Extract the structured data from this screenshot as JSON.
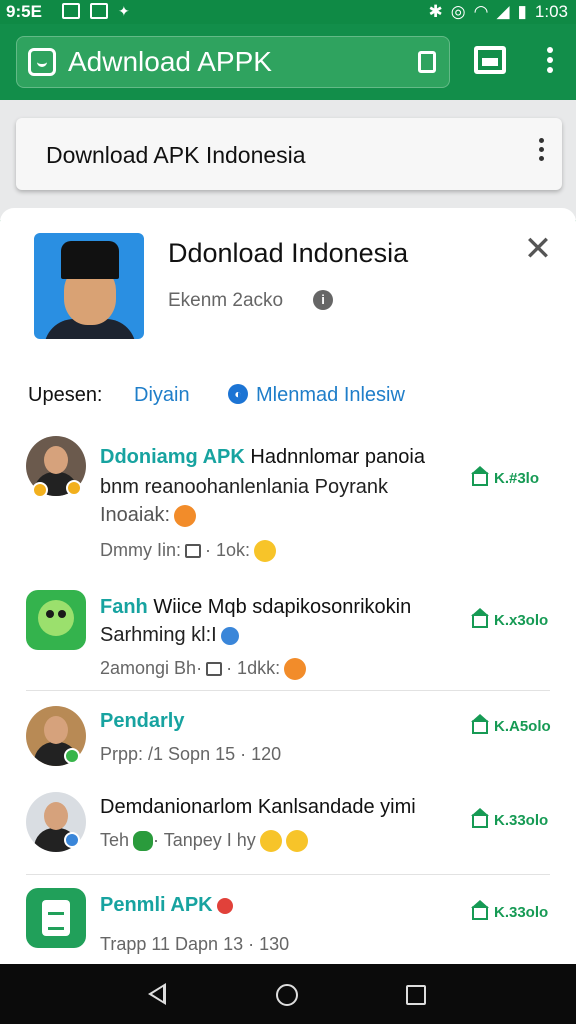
{
  "status_bar": {
    "time": "9:5E",
    "battery": "1:03"
  },
  "app_bar": {
    "url_text": "Adwnload APPK"
  },
  "search": {
    "text": "Download APK Indonesia"
  },
  "profile": {
    "title": "Ddonload Indonesia",
    "subtitle": "Ekenm 2acko"
  },
  "filters": {
    "label": "Upesen:",
    "link1": "Diyain",
    "link2": "Mlenmad Inlesiw"
  },
  "items": [
    {
      "title_highlight": "Ddoniamg APK",
      "title_rest": " Hadnnlomar panoia",
      "line2": "bnm reanoohanlenlania Poyrank",
      "line3": "Inoaiak:",
      "meta": "Dmmy Iin:",
      "meta2": "· 1ok:",
      "count": "K.#3lo"
    },
    {
      "title_highlight": "Fanh",
      "title_rest": " Wiice Mqb sdapikosonrikokin",
      "line2": "Sarhming kl:I",
      "meta": "2amongi Bh·",
      "meta2": "· 1dkk:",
      "count": "K.x3olo"
    },
    {
      "title_highlight": "Pendarly",
      "meta": "Prpp: /1 Sopn 15 · 120",
      "count": "K.A5olo"
    },
    {
      "title_rest": "Demdanionarlom Kanlsandade yimi",
      "meta": "Teh",
      "meta2": "· Tanpey I hy",
      "count": "K.33olo"
    },
    {
      "title_highlight": "Penmli APK",
      "meta": "Trapp 11 Dapn 13 · 130",
      "count": "K.33olo"
    }
  ],
  "colors": {
    "brand_green": "#128e4a",
    "link_blue": "#1f7ec9",
    "teal": "#17a3a0"
  }
}
